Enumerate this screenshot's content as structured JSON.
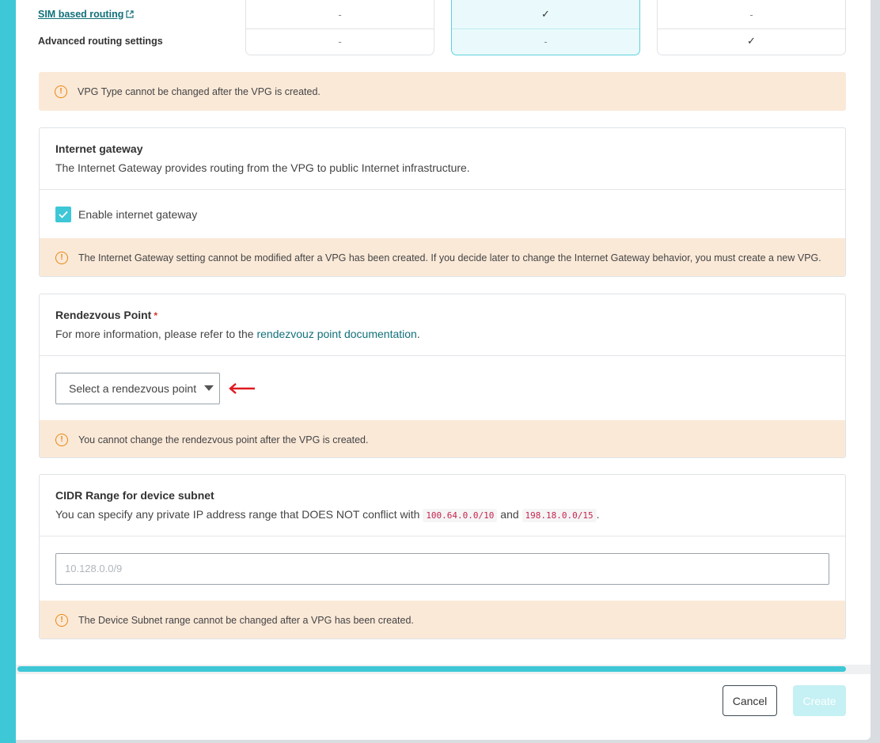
{
  "comparison": {
    "rows": [
      {
        "label": "SIM based routing",
        "values": [
          "-",
          "✓",
          "-"
        ]
      },
      {
        "label": "Advanced routing settings",
        "values": [
          "-",
          "-",
          "✓"
        ]
      }
    ]
  },
  "vpg_alert": "VPG Type cannot be changed after the VPG is created.",
  "internet_gateway": {
    "title": "Internet gateway",
    "description": "The Internet Gateway provides routing from the VPG to public Internet infrastructure.",
    "checkbox_label": "Enable internet gateway",
    "checked": true,
    "alert": "The Internet Gateway setting cannot be modified after a VPG has been created. If you decide later to change the Internet Gateway behavior, you must create a new VPG."
  },
  "rendezvous": {
    "title": "Rendezvous Point",
    "required_mark": "*",
    "desc_prefix": "For more information, please refer to the ",
    "desc_link": "rendezvouz point documentation",
    "desc_suffix": ".",
    "select_placeholder": "Select a rendezvous point",
    "alert": "You cannot change the rendezvous point after the VPG is created."
  },
  "cidr": {
    "title": "CIDR Range for device subnet",
    "desc_prefix": "You can specify any private IP address range that DOES NOT conflict with ",
    "code1": "100.64.0.0/10",
    "desc_mid": " and ",
    "code2": "198.18.0.0/15",
    "desc_suffix": ".",
    "placeholder": "10.128.0.0/9",
    "alert": "The Device Subnet range cannot be changed after a VPG has been created."
  },
  "footer": {
    "cancel_label": "Cancel",
    "create_label": "Create"
  },
  "colors": {
    "accent": "#3ec7d6",
    "warning_bg": "#fbe9d8",
    "warning_icon": "#e8870e",
    "link": "#12707a",
    "annotation_arrow": "#e0191f"
  },
  "icons": {
    "warning": "exclamation-circle-icon",
    "external_link": "external-link-icon",
    "checkbox": "check-icon",
    "dropdown": "caret-down-icon",
    "annotation": "red-left-arrow-annotation"
  }
}
